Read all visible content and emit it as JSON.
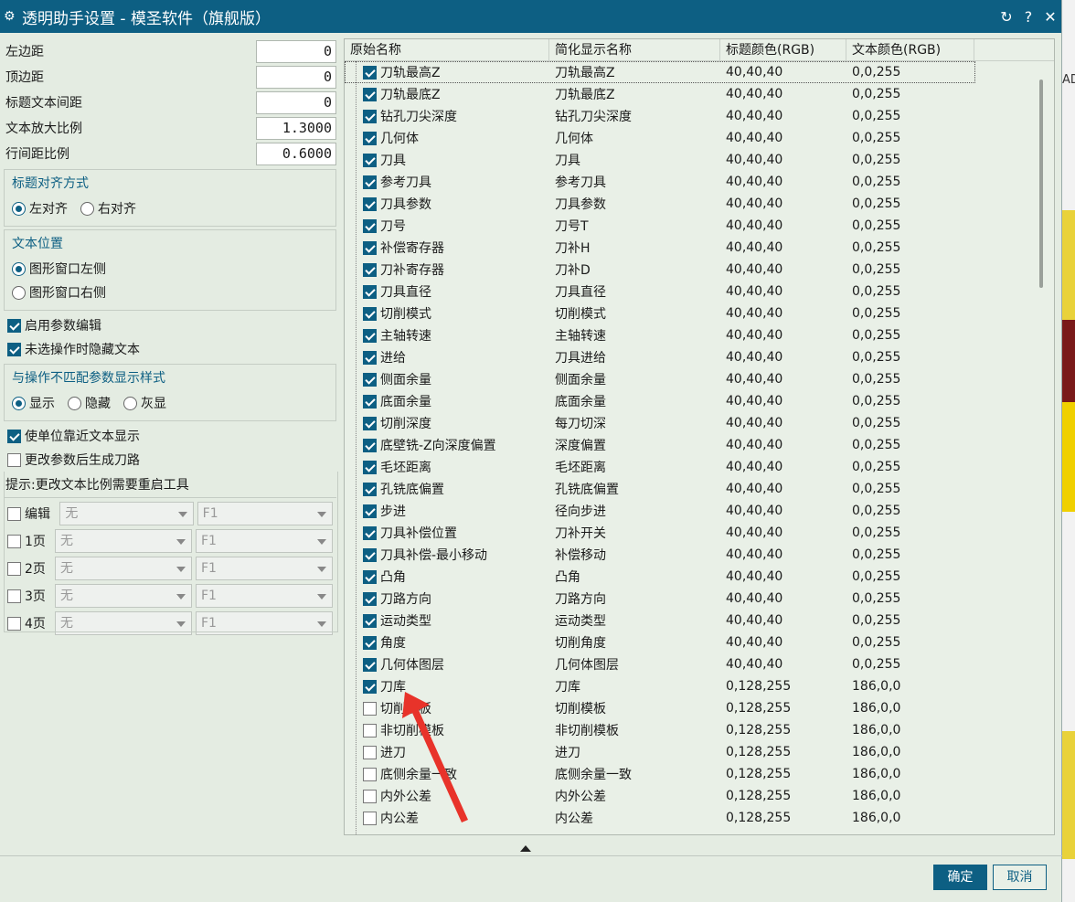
{
  "window": {
    "title": "透明助手设置 - 模圣软件（旗舰版）",
    "buttons": {
      "refresh": "↻",
      "help": "?",
      "close": "✕"
    }
  },
  "background_app": {
    "text": "AD"
  },
  "params": [
    {
      "label": "左边距",
      "value": "0"
    },
    {
      "label": "顶边距",
      "value": "0"
    },
    {
      "label": "标题文本间距",
      "value": "0"
    },
    {
      "label": "文本放大比例",
      "value": "1.3000"
    },
    {
      "label": "行间距比例",
      "value": "0.6000"
    }
  ],
  "title_align": {
    "title": "标题对齐方式",
    "left": "左对齐",
    "right": "右对齐",
    "selected": "left"
  },
  "text_pos": {
    "title": "文本位置",
    "left": "图形窗口左侧",
    "right": "图形窗口右侧",
    "selected": "left"
  },
  "enable_param_edit": {
    "label": "启用参数编辑",
    "checked": true
  },
  "hide_unselected": {
    "label": "未选操作时隐藏文本",
    "checked": true
  },
  "mismatch_style": {
    "title": "与操作不匹配参数显示样式",
    "show": "显示",
    "hide": "隐藏",
    "gray": "灰显",
    "selected": "show"
  },
  "unit_near_text": {
    "label": "使单位靠近文本显示",
    "checked": true
  },
  "gen_path": {
    "label": "更改参数后生成刀路",
    "checked": false
  },
  "hint": "提示:更改文本比例需要重启工具",
  "pages": [
    {
      "label": "编辑",
      "a": "无",
      "b": "F1"
    },
    {
      "label": "1页",
      "a": "无",
      "b": "F1"
    },
    {
      "label": "2页",
      "a": "无",
      "b": "F1"
    },
    {
      "label": "3页",
      "a": "无",
      "b": "F1"
    },
    {
      "label": "4页",
      "a": "无",
      "b": "F1"
    }
  ],
  "table": {
    "headers": [
      "原始名称",
      "简化显示名称",
      "标题颜色(RGB)",
      "文本颜色(RGB)"
    ],
    "rows": [
      [
        "刀轨最高Z",
        "刀轨最高Z",
        "40,40,40",
        "0,0,255",
        true
      ],
      [
        "刀轨最底Z",
        "刀轨最底Z",
        "40,40,40",
        "0,0,255",
        true
      ],
      [
        "钻孔刀尖深度",
        "钻孔刀尖深度",
        "40,40,40",
        "0,0,255",
        true
      ],
      [
        "几何体",
        "几何体",
        "40,40,40",
        "0,0,255",
        true
      ],
      [
        "刀具",
        "刀具",
        "40,40,40",
        "0,0,255",
        true
      ],
      [
        "参考刀具",
        "参考刀具",
        "40,40,40",
        "0,0,255",
        true
      ],
      [
        "刀具参数",
        "刀具参数",
        "40,40,40",
        "0,0,255",
        true
      ],
      [
        "刀号",
        "刀号T",
        "40,40,40",
        "0,0,255",
        true
      ],
      [
        "补偿寄存器",
        "刀补H",
        "40,40,40",
        "0,0,255",
        true
      ],
      [
        "刀补寄存器",
        "刀补D",
        "40,40,40",
        "0,0,255",
        true
      ],
      [
        "刀具直径",
        "刀具直径",
        "40,40,40",
        "0,0,255",
        true
      ],
      [
        "切削模式",
        "切削模式",
        "40,40,40",
        "0,0,255",
        true
      ],
      [
        "主轴转速",
        "主轴转速",
        "40,40,40",
        "0,0,255",
        true
      ],
      [
        "进给",
        "刀具进给",
        "40,40,40",
        "0,0,255",
        true
      ],
      [
        "侧面余量",
        "侧面余量",
        "40,40,40",
        "0,0,255",
        true
      ],
      [
        "底面余量",
        "底面余量",
        "40,40,40",
        "0,0,255",
        true
      ],
      [
        "切削深度",
        "每刀切深",
        "40,40,40",
        "0,0,255",
        true
      ],
      [
        "底壁铣-Z向深度偏置",
        "深度偏置",
        "40,40,40",
        "0,0,255",
        true
      ],
      [
        "毛坯距离",
        "毛坯距离",
        "40,40,40",
        "0,0,255",
        true
      ],
      [
        "孔铣底偏置",
        "孔铣底偏置",
        "40,40,40",
        "0,0,255",
        true
      ],
      [
        "步进",
        "径向步进",
        "40,40,40",
        "0,0,255",
        true
      ],
      [
        "刀具补偿位置",
        "刀补开关",
        "40,40,40",
        "0,0,255",
        true
      ],
      [
        "刀具补偿-最小移动",
        "补偿移动",
        "40,40,40",
        "0,0,255",
        true
      ],
      [
        "凸角",
        "凸角",
        "40,40,40",
        "0,0,255",
        true
      ],
      [
        "刀路方向",
        "刀路方向",
        "40,40,40",
        "0,0,255",
        true
      ],
      [
        "运动类型",
        "运动类型",
        "40,40,40",
        "0,0,255",
        true
      ],
      [
        "角度",
        "切削角度",
        "40,40,40",
        "0,0,255",
        true
      ],
      [
        "几何体图层",
        "几何体图层",
        "40,40,40",
        "0,0,255",
        true
      ],
      [
        "刀库",
        "刀库",
        "0,128,255",
        "186,0,0",
        true
      ],
      [
        "切削模板",
        "切削模板",
        "0,128,255",
        "186,0,0",
        false
      ],
      [
        "非切削模板",
        "非切削模板",
        "0,128,255",
        "186,0,0",
        false
      ],
      [
        "进刀",
        "进刀",
        "0,128,255",
        "186,0,0",
        false
      ],
      [
        "底侧余量一致",
        "底侧余量一致",
        "0,128,255",
        "186,0,0",
        false
      ],
      [
        "内外公差",
        "内外公差",
        "0,128,255",
        "186,0,0",
        false
      ],
      [
        "内公差",
        "内公差",
        "0,128,255",
        "186,0,0",
        false
      ]
    ]
  },
  "footer": {
    "ok": "确定",
    "cancel": "取消"
  },
  "colors": {
    "accent": "#0d5f83",
    "panel_bg": "#e4ece2",
    "annotation": "#e8332a"
  }
}
